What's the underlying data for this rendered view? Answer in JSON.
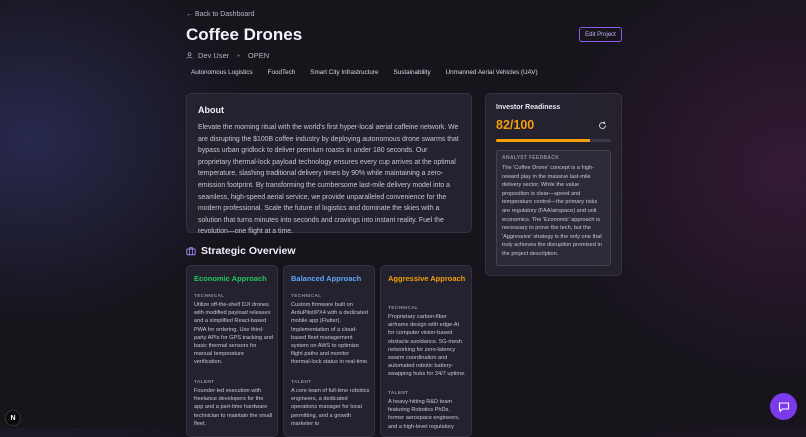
{
  "nav": {
    "back_label": "← Back to Dashboard"
  },
  "project": {
    "title": "Coffee Drones",
    "owner": "Dev User",
    "status": "OPEN",
    "edit_label": "Edit Project",
    "tags": [
      "Autonomous Logistics",
      "FoodTech",
      "Smart City Infrastructure",
      "Sustainability",
      "Unmanned Aerial Vehicles (UAV)"
    ]
  },
  "about": {
    "heading": "About",
    "text": "Elevate the morning ritual with the world's first hyper-local aerial caffeine network. We are disrupting the $100B coffee industry by deploying autonomous drone swarms that bypass urban gridlock to deliver premium roasts in under 180 seconds. Our proprietary thermal-lock payload technology ensures every cup arrives at the optimal temperature, slashing traditional delivery times by 90% while maintaining a zero-emission footprint. By transforming the cumbersome last-mile delivery model into a seamless, high-speed aerial service, we provide unparalleled convenience for the modern professional. Scale the future of logistics and dominate the skies with a solution that turns minutes into seconds and cravings into instant reality. Fuel the revolution—one flight at a time."
  },
  "investor": {
    "heading": "Investor Readiness",
    "score": "82/100",
    "score_value": 82,
    "feedback_label": "ANALYST FEEDBACK",
    "feedback": "The 'Coffee Drone' concept is a high-reward play in the massive last-mile delivery sector. While the value proposition is clear—speed and temperature control—the primary risks are regulatory (FAA/airspace) and unit economics. The 'Economic' approach is necessary to prove the tech, but the 'Aggressive' strategy is the only one that truly achieves the disruption promised in the project description."
  },
  "strategy": {
    "heading": "Strategic Overview",
    "technical_label": "TECHNICAL",
    "talent_label": "TALENT",
    "cards": [
      {
        "title": "Economic Approach",
        "color": "#22c55e",
        "technical": "Utilize off-the-shelf DJI drones with modified payload releases and a simplified React-based PWA for ordering. Use third-party APIs for GPS tracking and basic thermal sensors for manual temperature verification.",
        "talent": "Founder-led execution with freelance developers for the app and a part-time hardware technician to maintain the small fleet."
      },
      {
        "title": "Balanced Approach",
        "color": "#60a5fa",
        "technical": "Custom firmware built on ArduPilot/PX4 with a dedicated mobile app (Flutter). Implementation of a cloud-based fleet management system on AWS to optimize flight paths and monitor thermal-lock status in real-time.",
        "talent": "A core team of full-time robotics engineers, a dedicated operations manager for local permitting, and a growth marketer to"
      },
      {
        "title": "Aggressive Approach",
        "color": "#f59e0b",
        "technical": "Proprietary carbon-fiber airframe design with edge-AI for computer vision-based obstacle avoidance. 5G-mesh networking for zero-latency swarm coordination and automated robotic battery-swapping hubs for 24/7 uptime.",
        "talent": "A heavy-hitting R&D team featuring Robotics PhDs, former aerospace engineers, and a high-level regulatory"
      }
    ]
  },
  "badge": {
    "letter": "N"
  },
  "colors": {
    "accent": "#8b5cf6",
    "score": "#f59e0b",
    "chat": "#7c3aed"
  }
}
